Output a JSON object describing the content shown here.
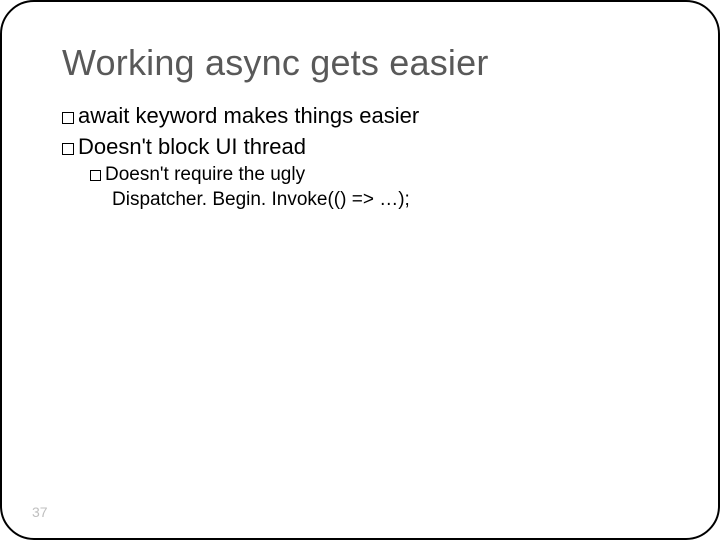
{
  "slide": {
    "title": "Working async gets easier",
    "bullets": {
      "b1": "await keyword makes things easier",
      "b2": "Doesn't block UI thread",
      "b2_1_line1": "Doesn't require the ugly",
      "b2_1_line2": "Dispatcher. Begin. Invoke(() => …);"
    },
    "page_number": "37"
  }
}
